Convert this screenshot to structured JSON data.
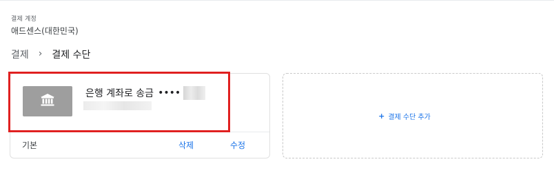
{
  "account": {
    "label": "결제 계정",
    "name": "애드센스(대한민국)"
  },
  "breadcrumb": {
    "parent": "결제",
    "separator": "›",
    "current": "결제 수단"
  },
  "payment_method": {
    "title": "은행 계좌로 송금",
    "masked_dots": "••••",
    "icon": "bank-icon",
    "status_label": "기본",
    "delete_label": "삭제",
    "edit_label": "수정"
  },
  "add_method": {
    "icon": "plus-icon",
    "plus": "+",
    "label": "결제 수단 추가"
  },
  "colors": {
    "link": "#1a73e8",
    "highlight_border": "#e02020",
    "thumb_bg": "#9e9e9e"
  }
}
